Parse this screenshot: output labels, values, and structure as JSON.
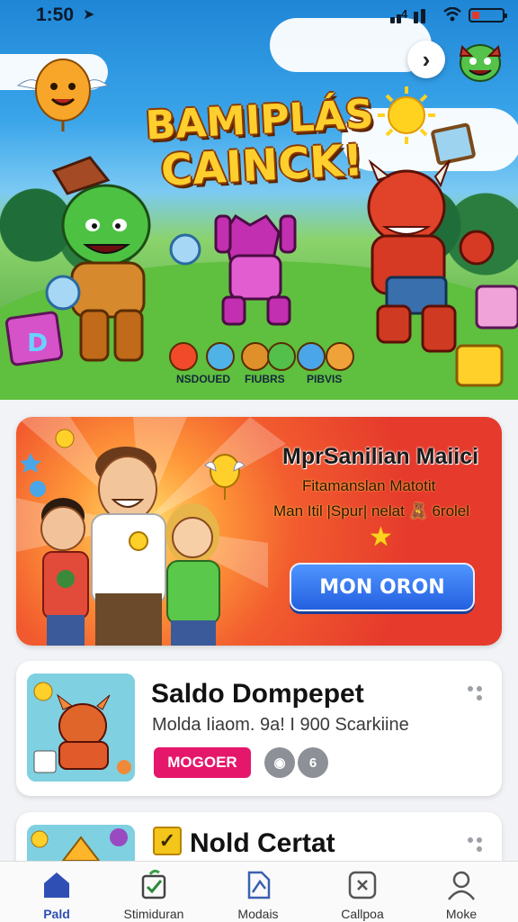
{
  "status_bar": {
    "time": "1:50",
    "signal_percent": "4"
  },
  "hero": {
    "title_line1": "BAMIPLÁS",
    "title_line2": "CAINCK!",
    "stats_labels": [
      "NSDOUED",
      "FIUBRS",
      "PIBVIS"
    ],
    "icons": [
      "next-arrow-icon",
      "monster-avatar-icon",
      "balloon-icon",
      "sun-icon"
    ]
  },
  "promo": {
    "title": "MprSanilian Maiici",
    "subtitle_line1": "Fitamanslan Matotit",
    "subtitle_line2": "Man Itil |Spur| nelat 🧸 6rolel",
    "button_label": "MON ORON",
    "star_icon": "★"
  },
  "cards": [
    {
      "title": "Saldo Dompepet",
      "description": "Molda Iiaom. 9a! I 900 Scarkiine",
      "tag": "MOGOER",
      "btn1_glyph": "◉",
      "btn2_glyph": "6"
    },
    {
      "check_glyph": "✓",
      "title": "Nold Certat"
    }
  ],
  "bottom_nav": [
    {
      "label": "Pald",
      "icon": "home-icon",
      "active": true
    },
    {
      "label": "Stimiduran",
      "icon": "checklist-icon",
      "active": false
    },
    {
      "label": "Modais",
      "icon": "document-icon",
      "active": false
    },
    {
      "label": "Callpoa",
      "icon": "scatter-icon",
      "active": false
    },
    {
      "label": "Moke",
      "icon": "person-icon",
      "active": false
    }
  ],
  "colors": {
    "accent_blue": "#2460e0",
    "tag_pink": "#e5176a",
    "nav_active": "#2f4fb5",
    "promo_red": "#e53a2c"
  }
}
